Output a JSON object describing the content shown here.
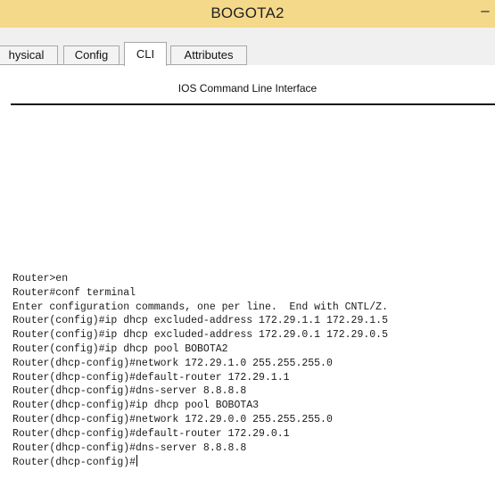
{
  "window": {
    "title": "BOGOTA2",
    "minimize_glyph": "–",
    "accent_color": "#f5d98a"
  },
  "tabs": [
    {
      "label": "Physical",
      "visible_text": "hysical",
      "active": false
    },
    {
      "label": "Config",
      "active": false
    },
    {
      "label": "CLI",
      "active": true
    },
    {
      "label": "Attributes",
      "active": false
    }
  ],
  "cli": {
    "header": "IOS Command Line Interface",
    "lines": [
      "Router>en",
      "Router#conf terminal",
      "Enter configuration commands, one per line.  End with CNTL/Z.",
      "Router(config)#ip dhcp excluded-address 172.29.1.1 172.29.1.5",
      "Router(config)#ip dhcp excluded-address 172.29.0.1 172.29.0.5",
      "Router(config)#ip dhcp pool BOBOTA2",
      "Router(dhcp-config)#network 172.29.1.0 255.255.255.0",
      "Router(dhcp-config)#default-router 172.29.1.1",
      "Router(dhcp-config)#dns-server 8.8.8.8",
      "Router(dhcp-config)#ip dhcp pool BOBOTA3",
      "Router(dhcp-config)#network 172.29.0.0 255.255.255.0",
      "Router(dhcp-config)#default-router 172.29.0.1",
      "Router(dhcp-config)#dns-server 8.8.8.8"
    ],
    "prompt": "Router(dhcp-config)#"
  }
}
